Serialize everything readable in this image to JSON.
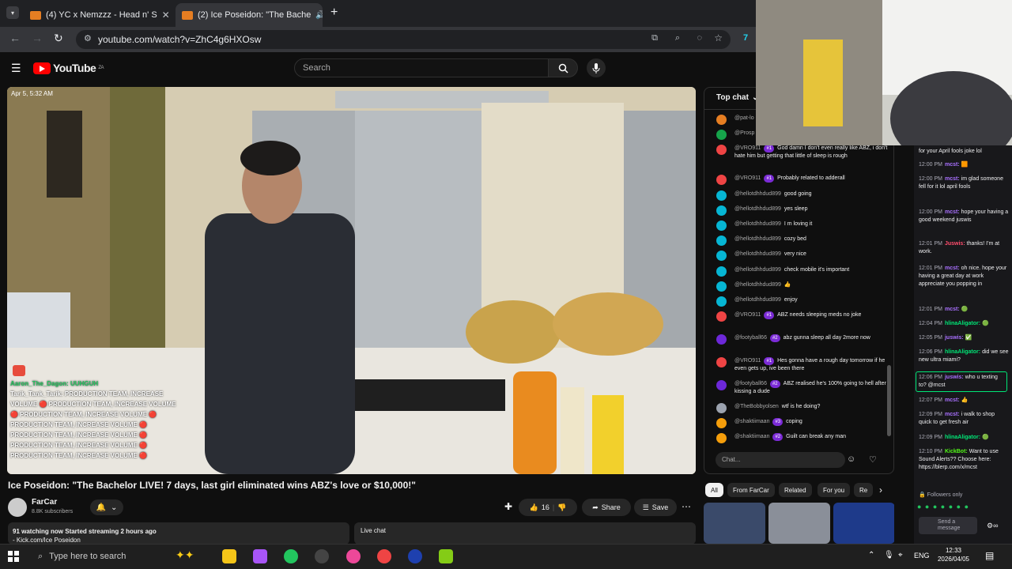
{
  "browser": {
    "tabs": [
      {
        "label": "(4) YC x Nemzzz - Head n' S",
        "active": false
      },
      {
        "label": "(2) Ice Poseidon: \"The Bache",
        "active": true
      }
    ],
    "url": "youtube.com/watch?v=ZhC4g6HXOsw"
  },
  "youtube": {
    "logo_text": "YouTube",
    "region_code": "ZA",
    "search_placeholder": "Search",
    "video": {
      "timestamp_overlay": "Apr 5, 5:32 AM",
      "overlay_lines": [
        {
          "text": "Aaron_The_Dagon: UUHGUH",
          "color": "#22c55e"
        },
        {
          "text": "Tarik_Tank_Tarik: PRODUCTION TEAM, INCREASE",
          "color": "#ffffff"
        },
        {
          "text": "VOLUME 🔴 PRODUCTION TEAM, INCREASE VOLUME",
          "color": "#ffffff"
        },
        {
          "text": "🔴 PRODUCTION TEAM, INCREASE VOLUME 🔴",
          "color": "#ffffff"
        },
        {
          "text": "PRODUCTION TEAM, INCREASE VOLUME 🔴",
          "color": "#ffffff"
        },
        {
          "text": "PRODUCTION TEAM, INCREASE VOLUME 🔴",
          "color": "#ffffff"
        },
        {
          "text": "PRODUCTION TEAM, INCREASE VOLUME 🔴",
          "color": "#ffffff"
        },
        {
          "text": "PRODUCTION TEAM, INCREASE VOLUME 🔴",
          "color": "#ffffff"
        }
      ],
      "title": "Ice Poseidon: \"The Bachelor LIVE! 7 days, last girl eliminated wins ABZ's love or $10,000!\""
    },
    "channel": {
      "name": "FarCar",
      "subscribers": "8.8K subscribers"
    },
    "actions": {
      "likes": "16",
      "share": "Share",
      "save": "Save"
    },
    "description": {
      "stats": "91 watching now  Started streaming 2 hours ago",
      "line2": "- Kick.com/Ice Poseidon"
    },
    "live_chat_button": "Live chat",
    "chat": {
      "mode": "Top chat",
      "messages": [
        {
          "author": "@pat-lo",
          "badge": "",
          "text": "",
          "color": "#e67e22"
        },
        {
          "author": "@Prosp",
          "badge": "",
          "text": "",
          "color": "#16a34a"
        },
        {
          "author": "@VRO911",
          "badge": "#1",
          "text": "God damn I don't even really like ABZ, i don't hate him but getting that little of sleep is rough",
          "color": "#ef4444"
        },
        {
          "author": "@VRO911",
          "badge": "#1",
          "text": "Probably related to adderall",
          "color": "#ef4444"
        },
        {
          "author": "@hellotdhhdud899",
          "badge": "",
          "text": "good going",
          "color": "#06b6d4"
        },
        {
          "author": "@hellotdhhdud899",
          "badge": "",
          "text": "yes sleep",
          "color": "#06b6d4"
        },
        {
          "author": "@hellotdhhdud899",
          "badge": "",
          "text": "I m loving it",
          "color": "#06b6d4"
        },
        {
          "author": "@hellotdhhdud899",
          "badge": "",
          "text": "cozy bed",
          "color": "#06b6d4"
        },
        {
          "author": "@hellotdhhdud899",
          "badge": "",
          "text": "very nice",
          "color": "#06b6d4"
        },
        {
          "author": "@hellotdhhdud899",
          "badge": "",
          "text": "check mobile it's important",
          "color": "#06b6d4"
        },
        {
          "author": "@hellotdhhdud899",
          "badge": "",
          "text": "👍",
          "color": "#06b6d4"
        },
        {
          "author": "@hellotdhhdud899",
          "badge": "",
          "text": "enjoy",
          "color": "#06b6d4"
        },
        {
          "author": "@VRO911",
          "badge": "#1",
          "text": "ABZ needs sleeping meds no joke",
          "color": "#ef4444"
        },
        {
          "author": "@footyball66",
          "badge": "#2",
          "text": "abz gunna sleep all day 2more now",
          "color": "#6d28d9"
        },
        {
          "author": "@VRO911",
          "badge": "#1",
          "text": "Hes gonna have a rough day tomorrow if he even gets up, ive been there",
          "color": "#ef4444"
        },
        {
          "author": "@footyball66",
          "badge": "#2",
          "text": "ABZ realised he's 100% going to hell after kissing a dude",
          "color": "#6d28d9"
        },
        {
          "author": "@TheBobbyolsen",
          "badge": "",
          "text": "wtf is he doing?",
          "color": "#9ca3af"
        },
        {
          "author": "@shaktiimaan",
          "badge": "#3",
          "text": "coping",
          "color": "#f59e0b"
        },
        {
          "author": "@shaktiimaan",
          "badge": "#2",
          "text": "Guilt can break any man",
          "color": "#f59e0b"
        }
      ],
      "input_placeholder": "Chat..."
    },
    "chips": [
      "All",
      "From FarCar",
      "Related",
      "For you",
      "Re"
    ]
  },
  "twitch": {
    "messages": [
      {
        "time": "",
        "name": "",
        "text": "for your April fools joke lol",
        "name_color": "#efeff1"
      },
      {
        "time": "12:00 PM",
        "name": "mcst:",
        "text": "🟧",
        "name_color": "#a970ff"
      },
      {
        "time": "12:00 PM",
        "name": "mcst:",
        "text": "im glad someone fell for it lol april fools",
        "name_color": "#a970ff"
      },
      {
        "time": "12:00 PM",
        "name": "mcst:",
        "text": "hope your having a good weekend juswis",
        "name_color": "#a970ff"
      },
      {
        "time": "12:01 PM",
        "name": "Juswis:",
        "text": "thanks! I'm at work.",
        "name_color": "#ff4d6d"
      },
      {
        "time": "12:01 PM",
        "name": "mcst:",
        "text": "oh nice. hope your having a great day at work appreciate you popping in",
        "name_color": "#a970ff"
      },
      {
        "time": "12:01 PM",
        "name": "mcst:",
        "text": "🟢",
        "name_color": "#a970ff"
      },
      {
        "time": "12:04 PM",
        "name": "hlinaAligator:",
        "text": "🟢",
        "name_color": "#00e676"
      },
      {
        "time": "12:05 PM",
        "name": "juswis:",
        "text": "✅",
        "name_color": "#a970ff"
      },
      {
        "time": "12:06 PM",
        "name": "hlinaAligator:",
        "text": "did we see new ultra miami?",
        "name_color": "#00e676"
      },
      {
        "time": "12:06 PM",
        "name": "juswis:",
        "text": "who u texting to? @mcst",
        "name_color": "#a970ff"
      },
      {
        "time": "12:07 PM",
        "name": "mcst:",
        "text": "👍",
        "name_color": "#a970ff"
      },
      {
        "time": "12:09 PM",
        "name": "mcst:",
        "text": "i walk to shop quick to get fresh air",
        "name_color": "#a970ff"
      },
      {
        "time": "12:09 PM",
        "name": "hlinaAligator:",
        "text": "🟢",
        "name_color": "#00e676"
      },
      {
        "time": "12:10 PM",
        "name": "KickBot:",
        "text": "Want to use Sound Alerts?? Choose here: https://blerp.com/x/mcst",
        "name_color": "#53fc18"
      }
    ],
    "followers_only": "Followers only",
    "send_message": "Send a message"
  },
  "taskbar": {
    "search_placeholder": "Type here to search",
    "language": "ENG",
    "time": "12:33",
    "date": "2026/04/05"
  }
}
